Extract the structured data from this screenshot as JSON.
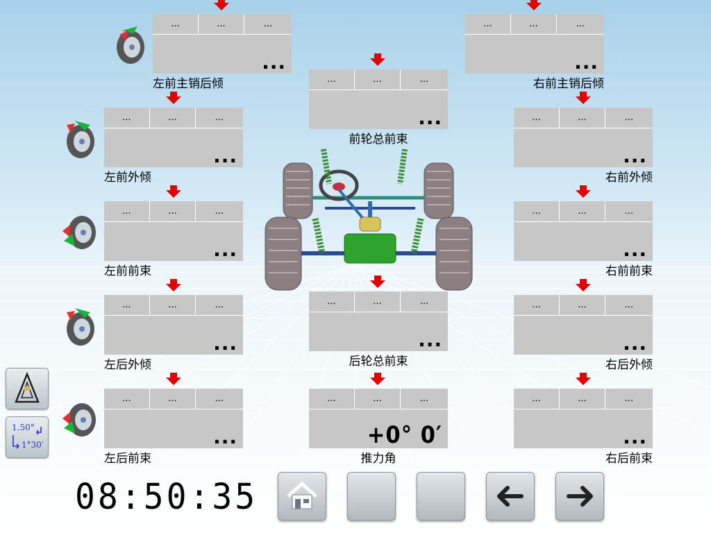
{
  "screen": {
    "title": ""
  },
  "panels": {
    "lf_caster": {
      "label": "左前主销后倾",
      "cells": [
        "...",
        "...",
        "..."
      ],
      "value": "..."
    },
    "rf_caster": {
      "label": "右前主销后倾",
      "cells": [
        "...",
        "...",
        "..."
      ],
      "value": "..."
    },
    "front_total_toe": {
      "label": "前轮总前束",
      "cells": [
        "...",
        "...",
        "..."
      ],
      "value": "..."
    },
    "lf_camber": {
      "label": "左前外倾",
      "cells": [
        "...",
        "...",
        "..."
      ],
      "value": "..."
    },
    "rf_camber": {
      "label": "右前外倾",
      "cells": [
        "...",
        "...",
        "..."
      ],
      "value": "..."
    },
    "lf_toe": {
      "label": "左前前束",
      "cells": [
        "...",
        "...",
        "..."
      ],
      "value": "..."
    },
    "rf_toe": {
      "label": "右前前束",
      "cells": [
        "...",
        "...",
        "..."
      ],
      "value": "..."
    },
    "lr_camber": {
      "label": "左后外倾",
      "cells": [
        "...",
        "...",
        "..."
      ],
      "value": "..."
    },
    "rear_total_toe": {
      "label": "后轮总前束",
      "cells": [
        "...",
        "...",
        "..."
      ],
      "value": "..."
    },
    "rr_camber": {
      "label": "右后外倾",
      "cells": [
        "...",
        "...",
        "..."
      ],
      "value": "..."
    },
    "lr_toe": {
      "label": "左后前束",
      "cells": [
        "...",
        "...",
        "..."
      ],
      "value": "..."
    },
    "thrust_angle": {
      "label": "推力角",
      "cells": [
        "...",
        "...",
        "..."
      ],
      "value": "+0° 0′"
    },
    "rr_toe": {
      "label": "右后前束",
      "cells": [
        "...",
        "...",
        "..."
      ],
      "value": "..."
    }
  },
  "side_buttons": {
    "unit_toggle": {
      "line1": "1.50°",
      "line2": "1°30′",
      "icon": "unit-convert-icon"
    },
    "measure": {
      "icon": "set-square-icon"
    }
  },
  "clock": {
    "time": "08:50:35"
  },
  "nav": {
    "home": {
      "icon": "home-icon"
    },
    "blank1": {
      "icon": ""
    },
    "blank2": {
      "icon": ""
    },
    "back": {
      "icon": "arrow-left-icon"
    },
    "next": {
      "icon": "arrow-right-icon"
    }
  },
  "colors": {
    "panel": "#c7c7c7",
    "arrow": "#e00000",
    "text": "#000000"
  }
}
